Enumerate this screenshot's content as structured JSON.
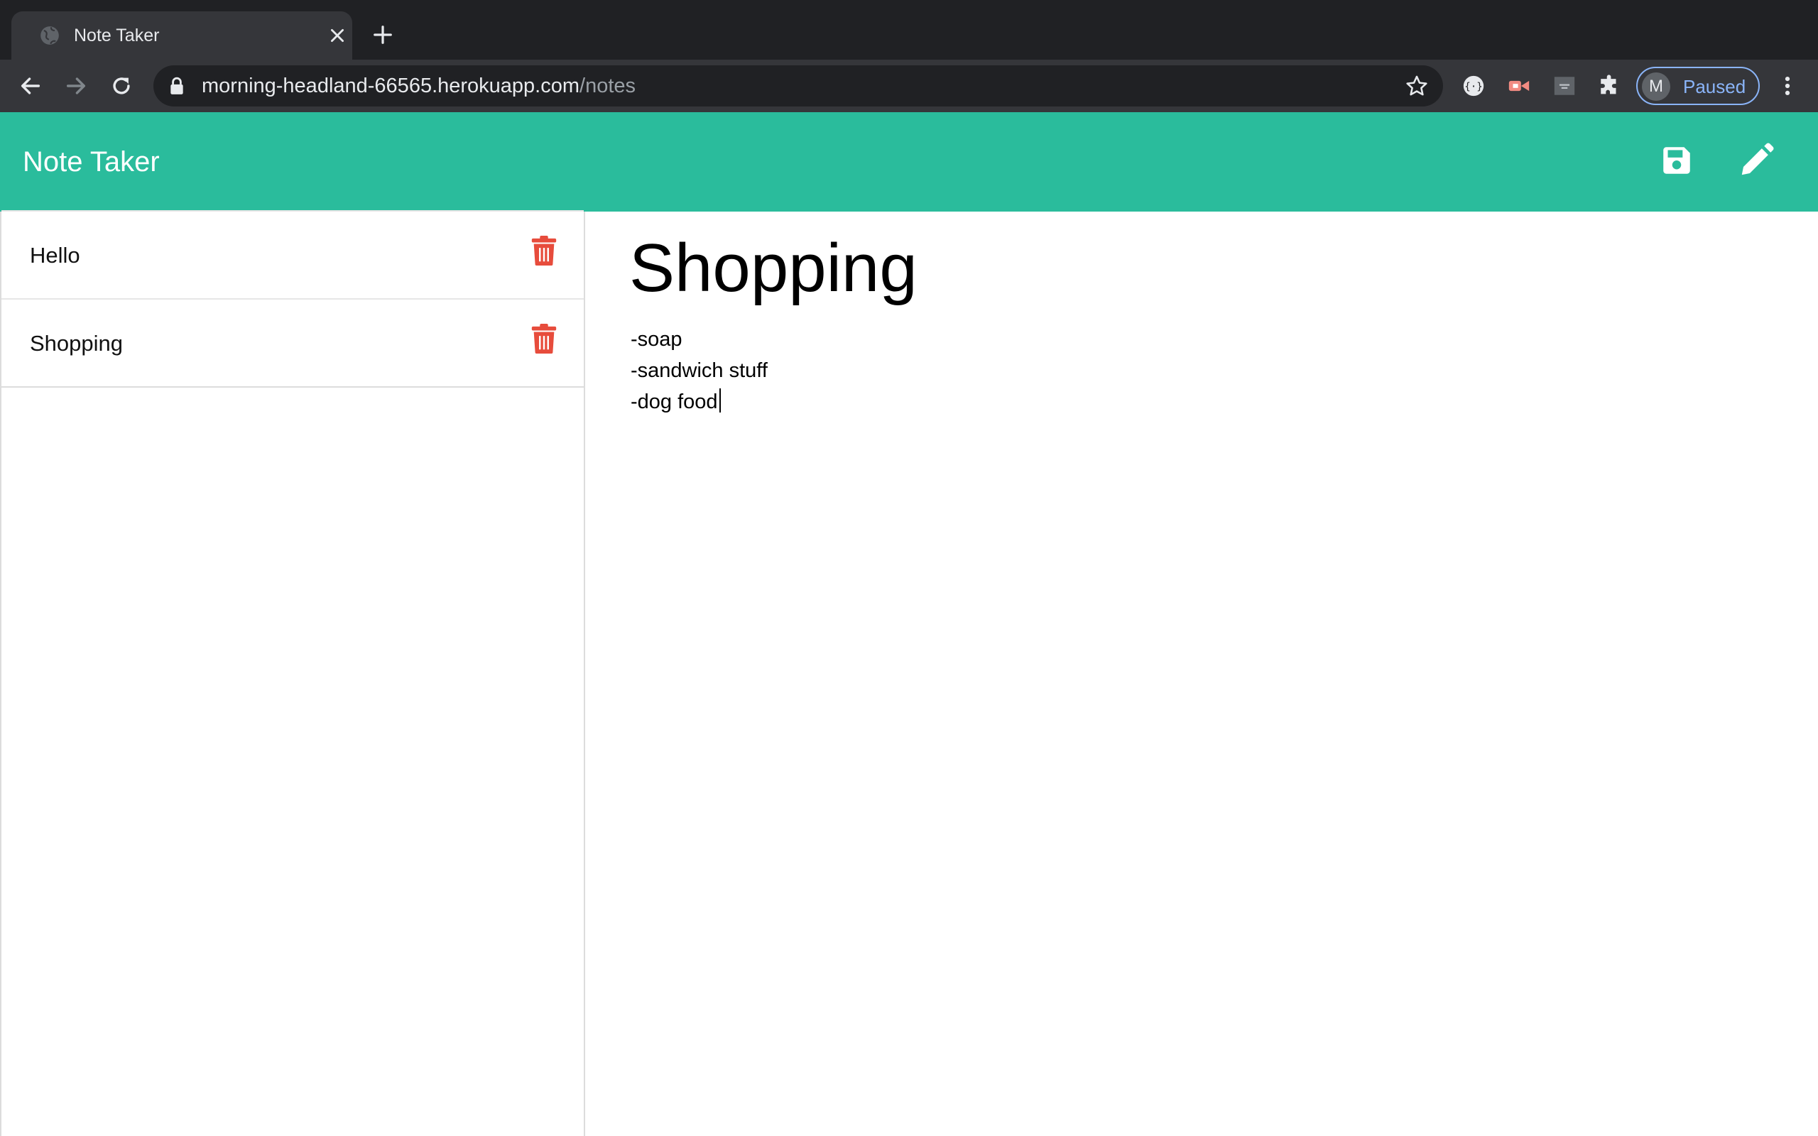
{
  "browser": {
    "tab": {
      "title": "Note Taker",
      "favicon": "globe-icon"
    },
    "url": {
      "host": "morning-headland-66565.herokuapp.com",
      "path": "/notes"
    },
    "profile": {
      "initial": "M",
      "status": "Paused"
    },
    "accent": "#8ab4f8"
  },
  "app": {
    "brand": "Note Taker",
    "header_color": "#2abc9c",
    "actions": {
      "save_icon": "save-icon",
      "new_icon": "pencil-icon"
    }
  },
  "notes": [
    {
      "title": "Hello"
    },
    {
      "title": "Shopping"
    }
  ],
  "editor": {
    "title": "Shopping",
    "body": "-soap\n-sandwich stuff\n-dog food"
  },
  "colors": {
    "delete": "#e74c3c"
  }
}
